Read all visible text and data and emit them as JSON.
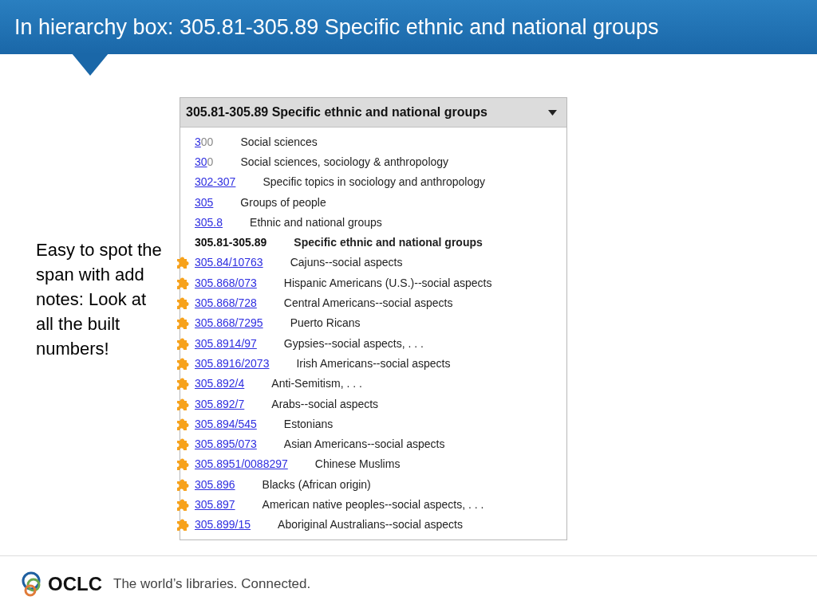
{
  "slide_title": "In hierarchy box: 305.81-305.89 Specific ethnic and national groups",
  "note": "Easy to spot the span with add notes: Look at all the built numbers!",
  "hierarchy_box": {
    "title": "305.81-305.89 Specific ethnic and national groups",
    "rows": [
      {
        "kind": "link",
        "number": "3",
        "number_suffix": "00",
        "description": "Social sciences"
      },
      {
        "kind": "link",
        "number": "30",
        "number_suffix": "0",
        "description": "Social sciences, sociology & anthropology"
      },
      {
        "kind": "link",
        "number": "302-307",
        "description": "Specific topics in sociology and anthropology"
      },
      {
        "kind": "link",
        "number": "305",
        "description": "Groups of people"
      },
      {
        "kind": "link",
        "number": "305.8",
        "description": "Ethnic and national groups"
      },
      {
        "kind": "current",
        "number": "305.81-305.89",
        "description": "Specific ethnic and national groups"
      },
      {
        "kind": "built",
        "number": "305.84/10763",
        "description": "Cajuns--social aspects"
      },
      {
        "kind": "built",
        "number": "305.868/073",
        "description": "Hispanic Americans (U.S.)--social aspects"
      },
      {
        "kind": "built",
        "number": "305.868/728",
        "description": "Central Americans--social aspects"
      },
      {
        "kind": "built",
        "number": "305.868/7295",
        "description": "Puerto Ricans"
      },
      {
        "kind": "built",
        "number": "305.8914/97",
        "description": "Gypsies--social aspects, . . ."
      },
      {
        "kind": "built",
        "number": "305.8916/2073",
        "description": "Irish Americans--social aspects"
      },
      {
        "kind": "built",
        "number": "305.892/4",
        "description": "Anti-Semitism, . . ."
      },
      {
        "kind": "built",
        "number": "305.892/7",
        "description": "Arabs--social aspects"
      },
      {
        "kind": "built",
        "number": "305.894/545",
        "description": "Estonians"
      },
      {
        "kind": "built",
        "number": "305.895/073",
        "description": "Asian Americans--social aspects"
      },
      {
        "kind": "built",
        "number": "305.8951/0088297",
        "description": "Chinese Muslims"
      },
      {
        "kind": "built",
        "number": "305.896",
        "description": "Blacks (African origin)"
      },
      {
        "kind": "built",
        "number": "305.897",
        "description": "American native peoples--social aspects, . . ."
      },
      {
        "kind": "built",
        "number": "305.899/15",
        "description": "Aboriginal Australians--social aspects"
      }
    ]
  },
  "footer": {
    "logo_text": "OCLC",
    "tagline": "The world’s libraries. Connected."
  }
}
